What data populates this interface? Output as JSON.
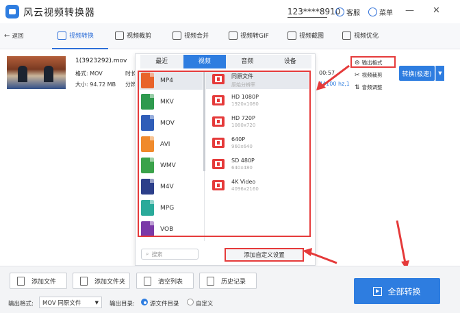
{
  "titlebar": {
    "title": "风云视频转换器",
    "phone": "123****8910",
    "service": "客服",
    "menu": "菜单",
    "minimize": "—",
    "close": "✕"
  },
  "nav": {
    "back": "返回",
    "items": [
      {
        "label": "视频转换"
      },
      {
        "label": "视频裁剪"
      },
      {
        "label": "视频合并"
      },
      {
        "label": "视频转GIF"
      },
      {
        "label": "视频截图"
      },
      {
        "label": "视频优化"
      }
    ]
  },
  "file": {
    "name": "1(3923292).mov",
    "format_label": "格式: MOV",
    "size_label": "大小: 94.72 MB",
    "duration_prefix": "时长",
    "res_prefix": "分辨",
    "duration_tail": "00:57",
    "audio_tail": "44100 hz,1",
    "output_format": "输出格式",
    "video_clip": "视频裁剪",
    "audio_adjust": "音频调整",
    "convert": "转换(极速)"
  },
  "panel": {
    "tabs": [
      "最近",
      "视频",
      "音频",
      "设备"
    ],
    "formats": [
      "MP4",
      "MKV",
      "MOV",
      "AVI",
      "WMV",
      "M4V",
      "MPG",
      "VOB"
    ],
    "qualities": [
      {
        "title": "同原文件",
        "sub": "原始分辨率"
      },
      {
        "title": "HD 1080P",
        "sub": "1920x1080"
      },
      {
        "title": "HD 720P",
        "sub": "1080x720"
      },
      {
        "title": "640P",
        "sub": "960x640"
      },
      {
        "title": "SD 480P",
        "sub": "640x480"
      },
      {
        "title": "4K Video",
        "sub": "4096x2160"
      }
    ],
    "search_placeholder": "搜索",
    "add_custom": "添加自定义设置"
  },
  "bottom": {
    "add_file": "添加文件",
    "add_folder": "添加文件夹",
    "clear_list": "清空列表",
    "history": "历史记录",
    "output_format_label": "输出格式:",
    "output_format_value": "MOV 同原文件",
    "output_dir_label": "输出目录:",
    "source_dir": "源文件目录",
    "custom": "自定义",
    "convert_all": "全部转换"
  },
  "colors": {
    "accent": "#2e7de0",
    "highlight": "#e53a3a"
  }
}
